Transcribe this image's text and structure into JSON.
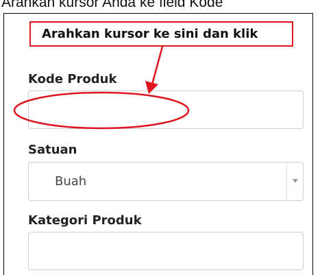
{
  "instruction_caption": "Arahkan kursor Anda ke field Kode",
  "callout": {
    "text": "Arahkan kursor ke sini dan klik"
  },
  "form": {
    "kode_produk": {
      "label": "Kode Produk",
      "value": ""
    },
    "satuan": {
      "label": "Satuan",
      "selected": "Buah"
    },
    "kategori_produk": {
      "label": "Kategori Produk",
      "value": ""
    }
  },
  "colors": {
    "annotation": "#e0141e",
    "input_border": "#cfcfcf",
    "label_text": "#222222"
  },
  "icons": {
    "select_arrow": "chevron-down-icon",
    "pointer_arrow": "red-arrow-icon"
  }
}
